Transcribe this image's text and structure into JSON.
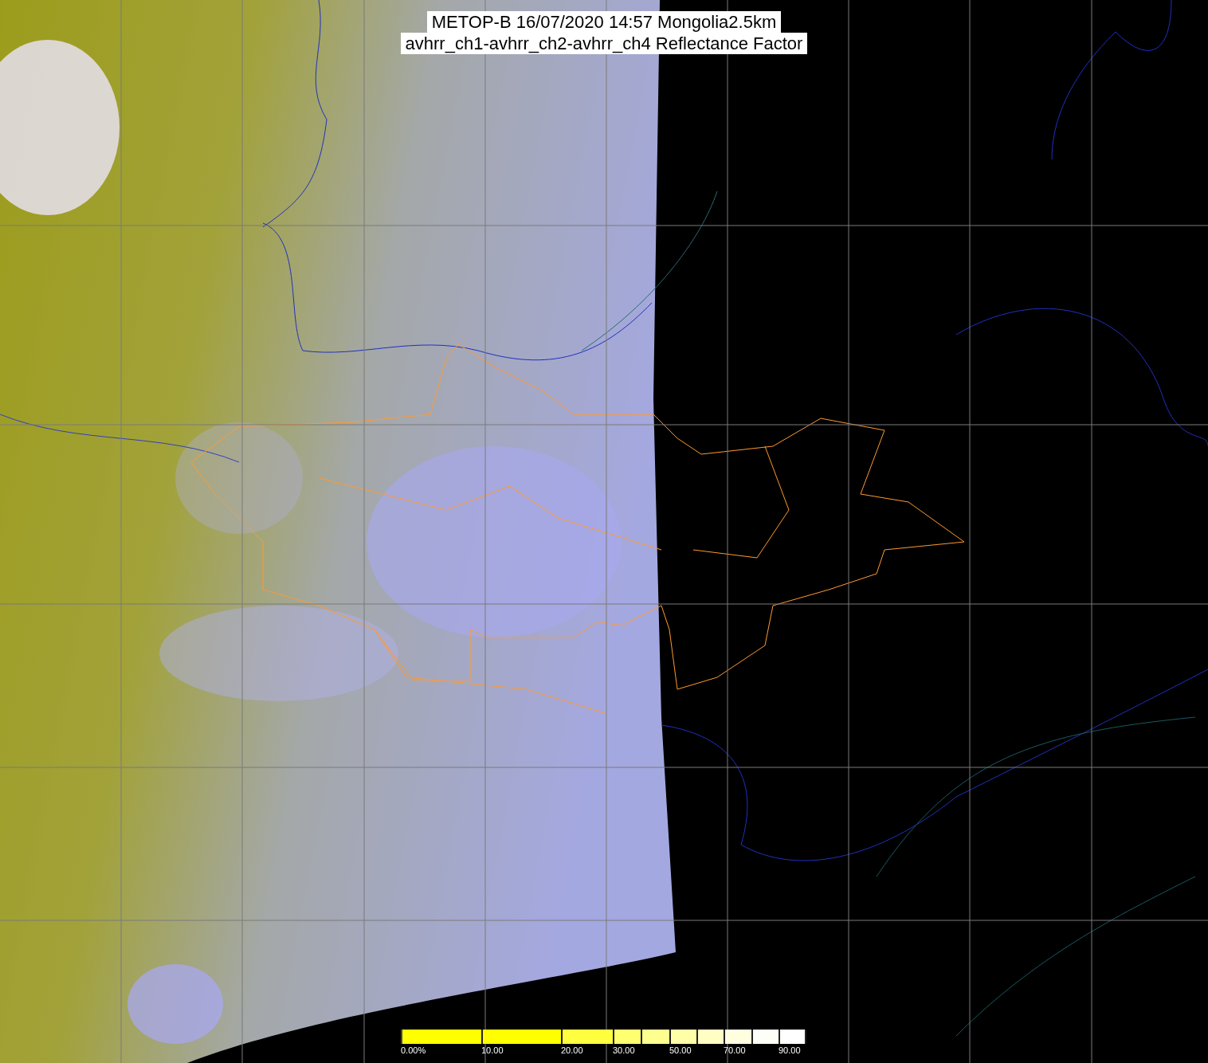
{
  "title_lines": [
    "METOP-B 16/07/2020 14:57 Mongolia2.5km",
    "avhrr_ch1-avhrr_ch2-avhrr_ch4 Reflectance Factor"
  ],
  "legend": {
    "segments": [
      {
        "color": "#ffff00"
      },
      {
        "color": "#ffff00"
      },
      {
        "color": "#ffff40"
      },
      {
        "color": "#ffff70"
      },
      {
        "color": "#ffff90"
      },
      {
        "color": "#ffffa8"
      },
      {
        "color": "#ffffc4"
      },
      {
        "color": "#ffffe0"
      },
      {
        "color": "#fefef8"
      },
      {
        "color": "#ffffff"
      }
    ],
    "labels": [
      "0.00%",
      "10.00",
      "20.00",
      "30.00",
      "50.00",
      "70.00",
      "90.00"
    ]
  }
}
